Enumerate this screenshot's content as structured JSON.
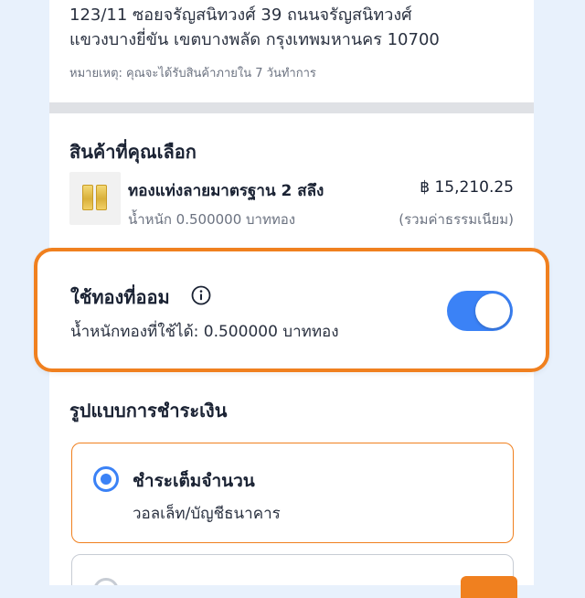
{
  "address": {
    "line1": "123/11 ซอยจรัญสนิทวงศ์ 39 ถนนจรัญสนิทวงศ์",
    "line2": "แขวงบางยี่ขัน เขตบางพลัด กรุงเทพมหานคร 10700",
    "note": "หมายเหตุ: คุณจะได้รับสินค้าภายใน 7 วันทำการ"
  },
  "selected_product": {
    "section_title": "สินค้าที่คุณเลือก",
    "name": "ทองแท่งลายมาตรฐาน 2 สลึง",
    "weight": "น้ำหนัก 0.500000 บาททอง",
    "price": "฿ 15,210.25",
    "fee_note": "(รวมค่าธรรมเนียม)",
    "thumbnail_icon": "gold-bar-icon"
  },
  "gold_savings": {
    "title": "ใช้ทองที่ออม",
    "available": "น้ำหนักทองที่ใช้ได้: 0.500000 บาททอง",
    "enabled": true,
    "highlight_color": "#f0801f",
    "toggle_color": "#3b82f6"
  },
  "payment": {
    "section_title": "รูปแบบการชำระเงิน",
    "options": [
      {
        "label": "ชำระเต็มจำนวน",
        "sub": "วอลเล็ท/บัญชีธนาคาร",
        "selected": true
      }
    ]
  },
  "colors": {
    "accent": "#f0801f",
    "primary": "#3b82f6",
    "background": "#e8f1fc"
  }
}
